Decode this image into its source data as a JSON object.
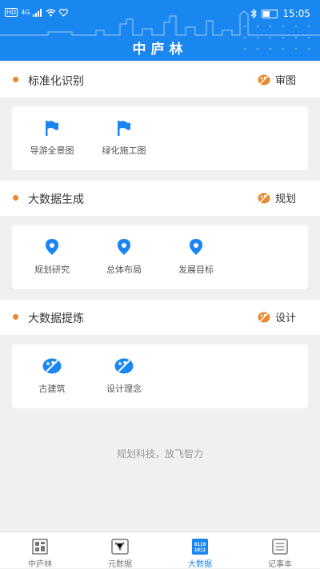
{
  "status_bar": {
    "network": "HD",
    "signal": "4G",
    "time": "15:05"
  },
  "app": {
    "title": "中庐林"
  },
  "sections": [
    {
      "name": "标准化识别",
      "tag": "审图",
      "items": [
        {
          "label": "导游全景图",
          "icon": "flag-icon"
        },
        {
          "label": "绿化施工图",
          "icon": "flag-icon"
        }
      ]
    },
    {
      "name": "大数据生成",
      "tag": "规划",
      "items": [
        {
          "label": "规划研究",
          "icon": "location-pin-icon"
        },
        {
          "label": "总体布局",
          "icon": "location-pin-icon"
        },
        {
          "label": "发展目标",
          "icon": "location-pin-icon"
        }
      ]
    },
    {
      "name": "大数据提炼",
      "tag": "设计",
      "items": [
        {
          "label": "古建筑",
          "icon": "palette-icon"
        },
        {
          "label": "设计理念",
          "icon": "palette-icon"
        }
      ]
    }
  ],
  "slogan": "规划科技，放飞智力",
  "tabs": [
    {
      "label": "中庐林",
      "icon": "home-logo-icon",
      "active": false
    },
    {
      "label": "元数据",
      "icon": "network-icon",
      "active": false
    },
    {
      "label": "大数据",
      "icon": "binary-icon",
      "active": true,
      "icon_text": [
        "0110",
        "1011"
      ]
    },
    {
      "label": "记事本",
      "icon": "notepad-icon",
      "active": false
    }
  ],
  "colors": {
    "primary": "#1a86f0",
    "accent": "#e8892f",
    "background": "#f0f0f0"
  }
}
